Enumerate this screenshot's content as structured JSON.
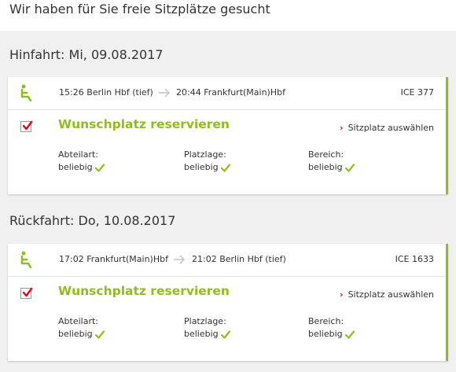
{
  "page": {
    "heading": "Wir haben für Sie freie Sitzplätze gesucht"
  },
  "colors": {
    "accent_green": "#8fbe1e",
    "link_red": "#ec0016",
    "background_gray": "#f0f0f0"
  },
  "trips": [
    {
      "heading": "Hinfahrt: Mi, 09.08.2017",
      "departure": "15:26 Berlin Hbf (tief)",
      "arrival": "20:44 Frankfurt(Main)Hbf",
      "train": "ICE 377",
      "option_title": "Wunschplatz reservieren",
      "checked": true,
      "select_link": "Sitzplatz auswählen",
      "properties": [
        {
          "label": "Abteilart:",
          "value": "beliebig"
        },
        {
          "label": "Platzlage:",
          "value": "beliebig"
        },
        {
          "label": "Bereich:",
          "value": "beliebig"
        }
      ]
    },
    {
      "heading": "Rückfahrt: Do, 10.08.2017",
      "departure": "17:02 Frankfurt(Main)Hbf",
      "arrival": "21:02 Berlin Hbf (tief)",
      "train": "ICE 1633",
      "option_title": "Wunschplatz reservieren",
      "checked": true,
      "select_link": "Sitzplatz auswählen",
      "properties": [
        {
          "label": "Abteilart:",
          "value": "beliebig"
        },
        {
          "label": "Platzlage:",
          "value": "beliebig"
        },
        {
          "label": "Bereich:",
          "value": "beliebig"
        }
      ]
    }
  ]
}
